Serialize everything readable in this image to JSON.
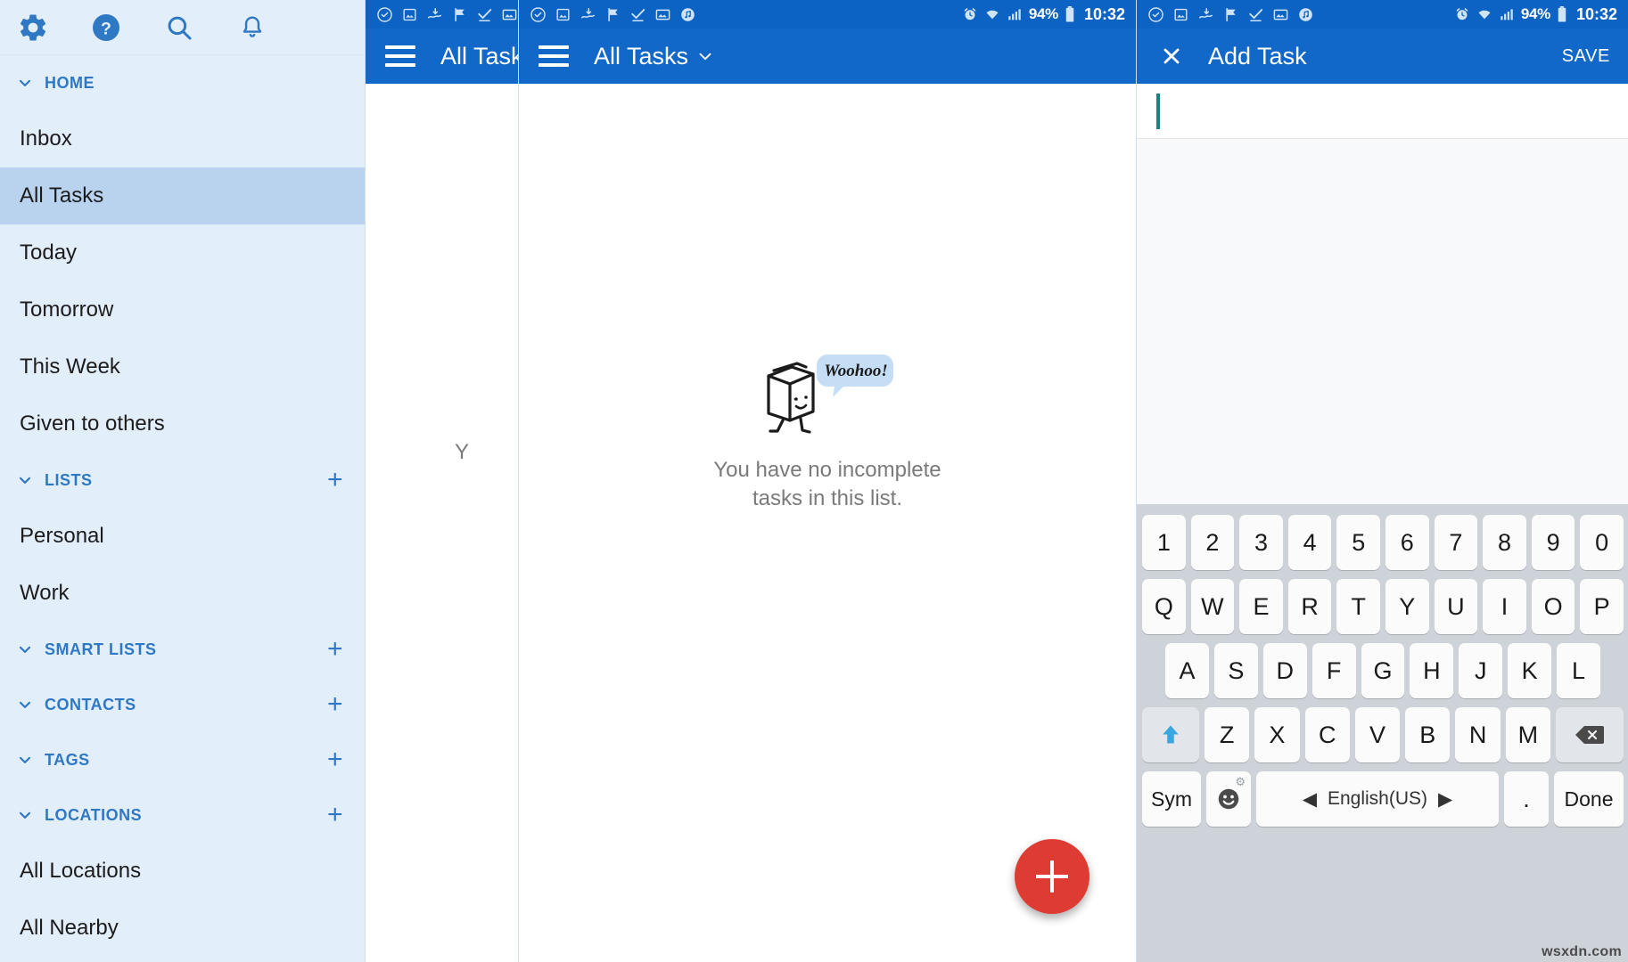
{
  "sidebar": {
    "toolbar_icons": [
      {
        "name": "gear-icon",
        "label": "Settings"
      },
      {
        "name": "help-icon",
        "label": "Help"
      },
      {
        "name": "search-icon",
        "label": "Search"
      },
      {
        "name": "bell-icon",
        "label": "Notifications"
      }
    ],
    "sections": [
      {
        "key": "home",
        "label": "HOME",
        "has_add": false,
        "items": [
          {
            "label": "Inbox",
            "active": false
          },
          {
            "label": "All Tasks",
            "active": true
          },
          {
            "label": "Today",
            "active": false
          },
          {
            "label": "Tomorrow",
            "active": false
          },
          {
            "label": "This Week",
            "active": false
          },
          {
            "label": "Given to others",
            "active": false
          }
        ]
      },
      {
        "key": "lists",
        "label": "LISTS",
        "has_add": true,
        "add_label": "+",
        "items": [
          {
            "label": "Personal",
            "active": false
          },
          {
            "label": "Work",
            "active": false
          }
        ]
      },
      {
        "key": "smart_lists",
        "label": "SMART LISTS",
        "has_add": true,
        "add_label": "+",
        "items": []
      },
      {
        "key": "contacts",
        "label": "CONTACTS",
        "has_add": true,
        "add_label": "+",
        "items": []
      },
      {
        "key": "tags",
        "label": "TAGS",
        "has_add": true,
        "add_label": "+",
        "items": []
      },
      {
        "key": "locations",
        "label": "LOCATIONS",
        "has_add": true,
        "add_label": "+",
        "items": [
          {
            "label": "All Locations",
            "active": false
          },
          {
            "label": "All Nearby",
            "active": false
          }
        ]
      }
    ]
  },
  "statusbar": {
    "left_icons": [
      "clock-check-icon",
      "image-icon",
      "download-icon",
      "flag-icon",
      "check-icon",
      "photo-icon",
      "music-icon"
    ],
    "right_icons": [
      "alarm-icon",
      "wifi-icon",
      "signal-icon"
    ],
    "battery_percent": "94%",
    "time": "10:32"
  },
  "tasks_panel": {
    "title": "All Tasks",
    "menu_icon": "hamburger-icon",
    "caret_icon": "chevron-down-icon",
    "empty_state": {
      "bubble_text": "Woohoo!",
      "message_line1": "You have no incomplete",
      "message_line2": "tasks in this list.",
      "art_name": "milk-carton-character"
    },
    "fab_label": "+",
    "fab_color": "#de3c32",
    "clipped_fragment": "Y"
  },
  "add_task": {
    "close_icon": "close-icon",
    "title": "Add Task",
    "save_label": "SAVE",
    "input_value": "",
    "input_placeholder": ""
  },
  "keyboard": {
    "row1": [
      "1",
      "2",
      "3",
      "4",
      "5",
      "6",
      "7",
      "8",
      "9",
      "0"
    ],
    "row2": [
      "Q",
      "W",
      "E",
      "R",
      "T",
      "Y",
      "U",
      "I",
      "O",
      "P"
    ],
    "row3": [
      "A",
      "S",
      "D",
      "F",
      "G",
      "H",
      "J",
      "K",
      "L"
    ],
    "row4": [
      "Z",
      "X",
      "C",
      "V",
      "B",
      "N",
      "M"
    ],
    "shift_icon": "shift-up-arrow-icon",
    "backspace_icon": "backspace-icon",
    "sym_label": "Sym",
    "emoji_icon": "emoji-smiley-icon",
    "language_label": "English(US)",
    "language_prev_icon": "triangle-left-icon",
    "language_next_icon": "triangle-right-icon",
    "period_label": ".",
    "done_label": "Done"
  },
  "watermark": "wsxdn.com",
  "colors": {
    "sidebar_bg": "#e3eefb",
    "sidebar_active": "#b9d3ee",
    "accent_blue": "#2f78c4",
    "appbar_blue": "#1168c8",
    "statusbar_blue": "#0c63c4",
    "fab_red": "#de3c32",
    "caret_teal": "#14857f",
    "keyboard_bg": "#ced3da"
  }
}
